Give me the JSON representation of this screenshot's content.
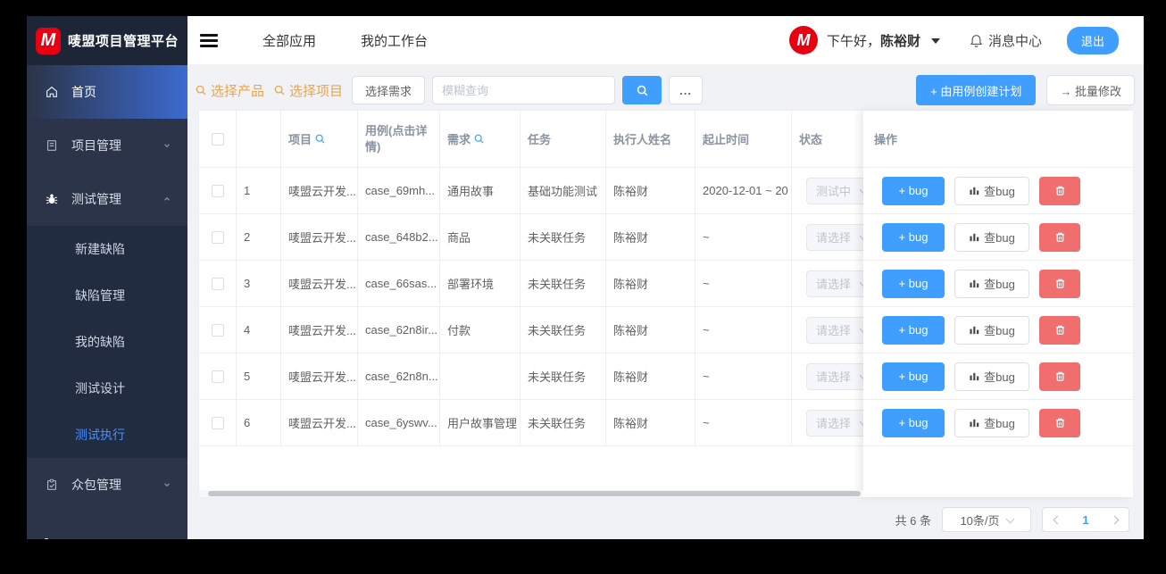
{
  "brand": {
    "logo_letter": "M",
    "title": "唛盟项目管理平台"
  },
  "topbar": {
    "tab_all_apps": "全部应用",
    "tab_workbench": "我的工作台",
    "avatar_letter": "M",
    "greeting": "下午好，",
    "username": "陈裕财",
    "message_center": "消息中心",
    "logout": "退出"
  },
  "sidebar": {
    "home": "首页",
    "project_mgmt": "项目管理",
    "test_mgmt": "测试管理",
    "crowd_mgmt": "众包管理",
    "submenu": {
      "new_defect": "新建缺陷",
      "defect_mgmt": "缺陷管理",
      "my_defects": "我的缺陷",
      "test_design": "测试设计",
      "test_execution": "测试执行"
    },
    "active_item": "测试执行"
  },
  "toolbar": {
    "select_product": "选择产品",
    "select_project": "选择项目",
    "select_requirement": "选择需求",
    "search_placeholder": "模糊查询",
    "more": "...",
    "create_plan": "+ 由用例创建计划",
    "batch_edit": "→ 批量修改"
  },
  "table": {
    "headers": {
      "project": "项目",
      "case": "用例(点击详情)",
      "requirement": "需求",
      "task": "任务",
      "executor": "执行人姓名",
      "time": "起止时间",
      "status": "状态",
      "ops": "操作"
    },
    "rows": [
      {
        "index": "1",
        "project": "唛盟云开发...",
        "case": "case_69mh...",
        "requirement": "通用故事",
        "task": "基础功能测试",
        "executor": "陈裕财",
        "time": "2020-12-01 ~ 20",
        "status": "测试中"
      },
      {
        "index": "2",
        "project": "唛盟云开发...",
        "case": "case_648b2...",
        "requirement": "商品",
        "task": "未关联任务",
        "executor": "陈裕财",
        "time": "~",
        "status": "请选择"
      },
      {
        "index": "3",
        "project": "唛盟云开发...",
        "case": "case_66sas...",
        "requirement": "部署环境",
        "task": "未关联任务",
        "executor": "陈裕财",
        "time": "~",
        "status": "请选择"
      },
      {
        "index": "4",
        "project": "唛盟云开发...",
        "case": "case_62n8ir...",
        "requirement": "付款",
        "task": "未关联任务",
        "executor": "陈裕财",
        "time": "~",
        "status": "请选择"
      },
      {
        "index": "5",
        "project": "唛盟云开发...",
        "case": "case_62n8n...",
        "requirement": "",
        "task": "未关联任务",
        "executor": "陈裕财",
        "time": "~",
        "status": "请选择"
      },
      {
        "index": "6",
        "project": "唛盟云开发...",
        "case": "case_6yswv...",
        "requirement": "用户故事管理",
        "task": "未关联任务",
        "executor": "陈裕财",
        "time": "~",
        "status": "请选择"
      }
    ],
    "ops_buttons": {
      "add_bug": "+ bug",
      "view_bug": "查bug"
    }
  },
  "pagination": {
    "total": "共 6 条",
    "page_size": "10条/页",
    "current_page": "1"
  },
  "colors": {
    "primary": "#409eff",
    "danger": "#f06e6e",
    "logo_red": "#e60012",
    "orange_link": "#eba54b",
    "sidebar_bg": "#2b3448",
    "active_gradient_end": "#3c6ad0"
  }
}
